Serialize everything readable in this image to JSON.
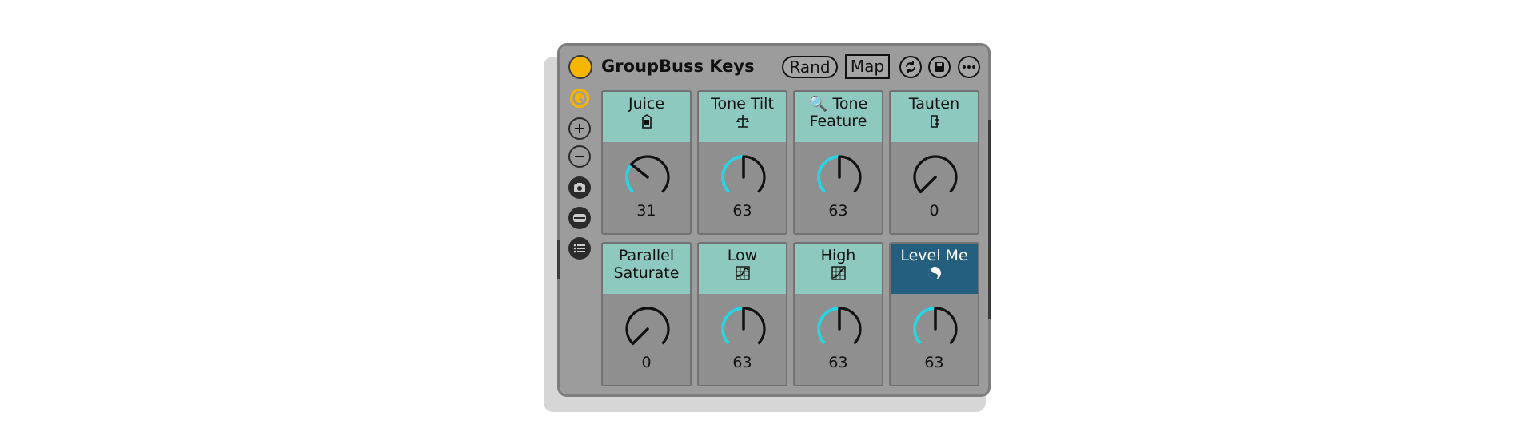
{
  "device": {
    "title": "GroupBuss Keys",
    "power_color": "#f7b500",
    "rand_label": "Rand",
    "map_label": "Map",
    "icons": [
      "refresh-icon",
      "save-icon",
      "more-icon"
    ]
  },
  "sidebar": {
    "items": [
      {
        "name": "macro-variation-icon"
      },
      {
        "name": "add-icon"
      },
      {
        "name": "remove-icon"
      },
      {
        "name": "snapshot-icon"
      },
      {
        "name": "show-mappings-icon"
      },
      {
        "name": "list-icon"
      }
    ]
  },
  "colors": {
    "knob_arc": "#2ad3e0",
    "header_teal": "#8ec9bf",
    "header_active": "#245f80"
  },
  "macros": [
    {
      "label": "Juice",
      "icon": "juice-carton-icon",
      "value": "31",
      "level": 0.31
    },
    {
      "label": "Tone Tilt",
      "icon": "scale-icon",
      "value": "63",
      "level": 0.5
    },
    {
      "label": "🔍 Tone\nFeature",
      "icon": "magnifier-icon",
      "value": "63",
      "level": 0.5
    },
    {
      "label": "Tauten",
      "icon": "clamp-icon",
      "value": "0",
      "level": 0
    },
    {
      "label": "Parallel\nSaturate",
      "icon": "",
      "value": "0",
      "level": 0
    },
    {
      "label": "Low",
      "icon": "low-eq-icon",
      "value": "63",
      "level": 0.5
    },
    {
      "label": "High",
      "icon": "high-eq-icon",
      "value": "63",
      "level": 0.5
    },
    {
      "label": "Level Me",
      "icon": "yin-yang-icon",
      "value": "63",
      "level": 0.5,
      "selected": true
    }
  ]
}
